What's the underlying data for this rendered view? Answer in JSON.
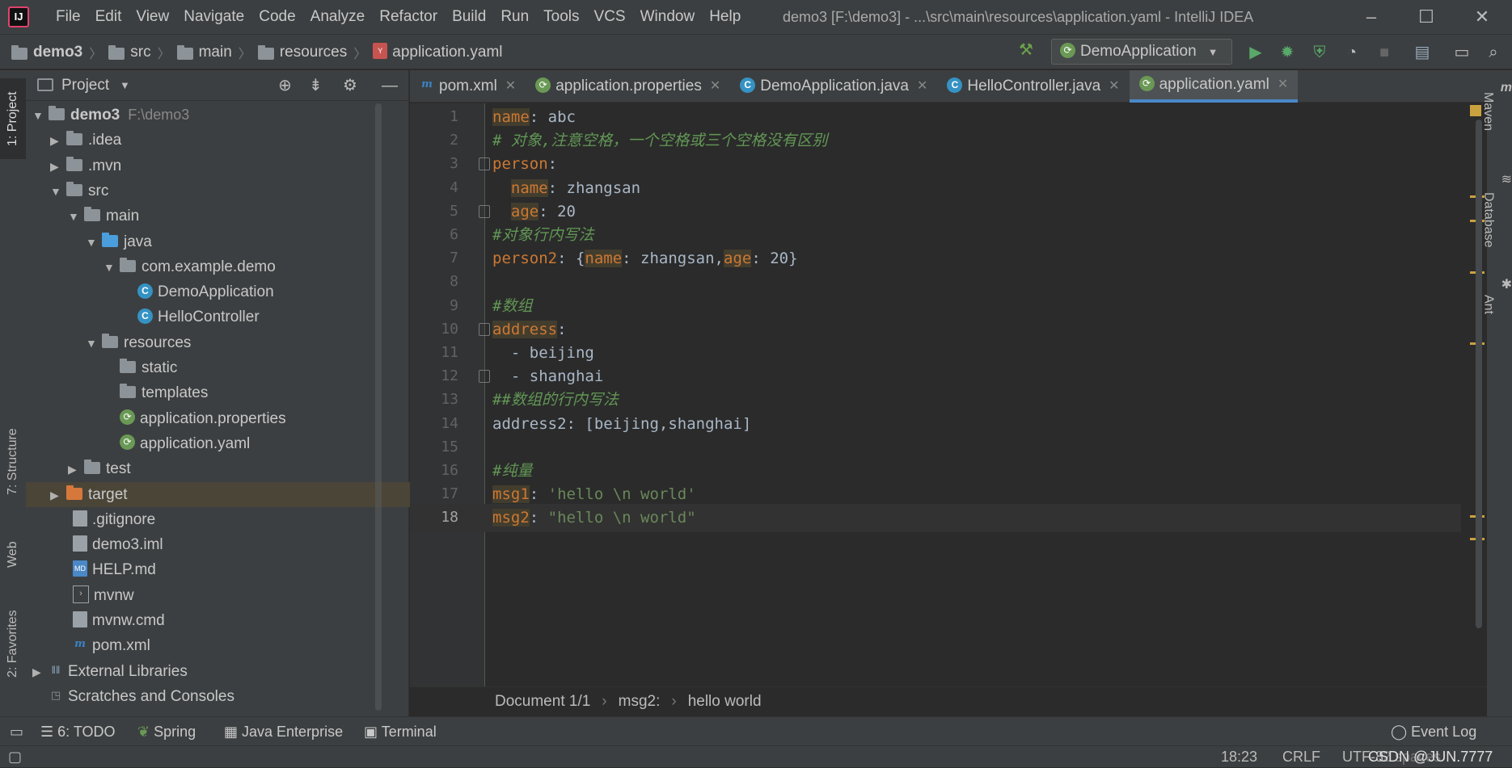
{
  "window": {
    "title": "demo3 [F:\\demo3] - ...\\src\\main\\resources\\application.yaml - IntelliJ IDEA",
    "logo": "IJ",
    "controls": {
      "minimize": "–",
      "maximize": "☐",
      "close": "✕"
    }
  },
  "menu": [
    "File",
    "Edit",
    "View",
    "Navigate",
    "Code",
    "Analyze",
    "Refactor",
    "Build",
    "Run",
    "Tools",
    "VCS",
    "Window",
    "Help"
  ],
  "breadcrumb": [
    "demo3",
    "src",
    "main",
    "resources",
    "application.yaml"
  ],
  "toolbar": {
    "run_config": "DemoApplication"
  },
  "left_tabs": {
    "project": "1: Project",
    "structure": "7: Structure",
    "web": "Web",
    "favorites": "2: Favorites"
  },
  "right_tabs": {
    "maven": "Maven",
    "database": "Database",
    "ant": "Ant"
  },
  "project_panel": {
    "title": "Project",
    "tree": [
      {
        "label": "demo3",
        "extra": "F:\\demo3"
      },
      {
        "label": ".idea"
      },
      {
        "label": ".mvn"
      },
      {
        "label": "src"
      },
      {
        "label": "main"
      },
      {
        "label": "java"
      },
      {
        "label": "com.example.demo"
      },
      {
        "label": "DemoApplication"
      },
      {
        "label": "HelloController"
      },
      {
        "label": "resources"
      },
      {
        "label": "static"
      },
      {
        "label": "templates"
      },
      {
        "label": "application.properties"
      },
      {
        "label": "application.yaml"
      },
      {
        "label": "test"
      },
      {
        "label": "target"
      },
      {
        "label": ".gitignore"
      },
      {
        "label": "demo3.iml"
      },
      {
        "label": "HELP.md"
      },
      {
        "label": "mvnw"
      },
      {
        "label": "mvnw.cmd"
      },
      {
        "label": "pom.xml"
      },
      {
        "label": "External Libraries"
      },
      {
        "label": "Scratches and Consoles"
      }
    ]
  },
  "tabs": [
    "pom.xml",
    "application.properties",
    "DemoApplication.java",
    "HelloController.java",
    "application.yaml"
  ],
  "editor": {
    "line_numbers": [
      "1",
      "2",
      "3",
      "4",
      "5",
      "6",
      "7",
      "8",
      "9",
      "10",
      "11",
      "12",
      "13",
      "14",
      "15",
      "16",
      "17",
      "18"
    ],
    "lines": {
      "l1_key": "name",
      "l1_rest": ": abc",
      "l2": "# 对象,注意空格，一个空格或三个空格没有区别",
      "l3_key": "person",
      "l3_rest": ":",
      "l4_indent": "  ",
      "l4_key": "name",
      "l4_rest": ": zhangsan",
      "l5_indent": "  ",
      "l5_key": "age",
      "l5_rest": ": 20",
      "l6": "#对象行内写法",
      "l7_a": "person2",
      "l7_b": ": {",
      "l7_k1": "name",
      "l7_c": ": zhangsan,",
      "l7_k2": "age",
      "l7_d": ": 20}",
      "l9": "#数组",
      "l10_key": "address",
      "l10_rest": ":",
      "l11": "  - beijing",
      "l12": "  - shanghai",
      "l13": "##数组的行内写法",
      "l14": "address2: [beijing,shanghai]",
      "l16": "#纯量",
      "l17_key": "msg1",
      "l17_b": ": ",
      "l17_str": "'hello \\n world'",
      "l18_key": "msg2",
      "l18_b": ": ",
      "l18_str": "\"hello \\n world\""
    }
  },
  "editor_breadcrumb": [
    "Document 1/1",
    "msg2:",
    "hello  world"
  ],
  "bottom_tools": {
    "todo": "6: TODO",
    "spring": "Spring",
    "java_enterprise": "Java Enterprise",
    "terminal": "Terminal",
    "event_log": "Event Log"
  },
  "status": {
    "position": "18:23",
    "line_sep": "CRLF",
    "encoding": "UTF-8",
    "indent": "2 spaces",
    "watermark": "CSDN @JUN.7777"
  },
  "colors": {
    "accent": "#4a88c7",
    "keyword": "#cc7832",
    "comment": "#629755",
    "string": "#6a8759",
    "selected_row": "#4b4538"
  }
}
